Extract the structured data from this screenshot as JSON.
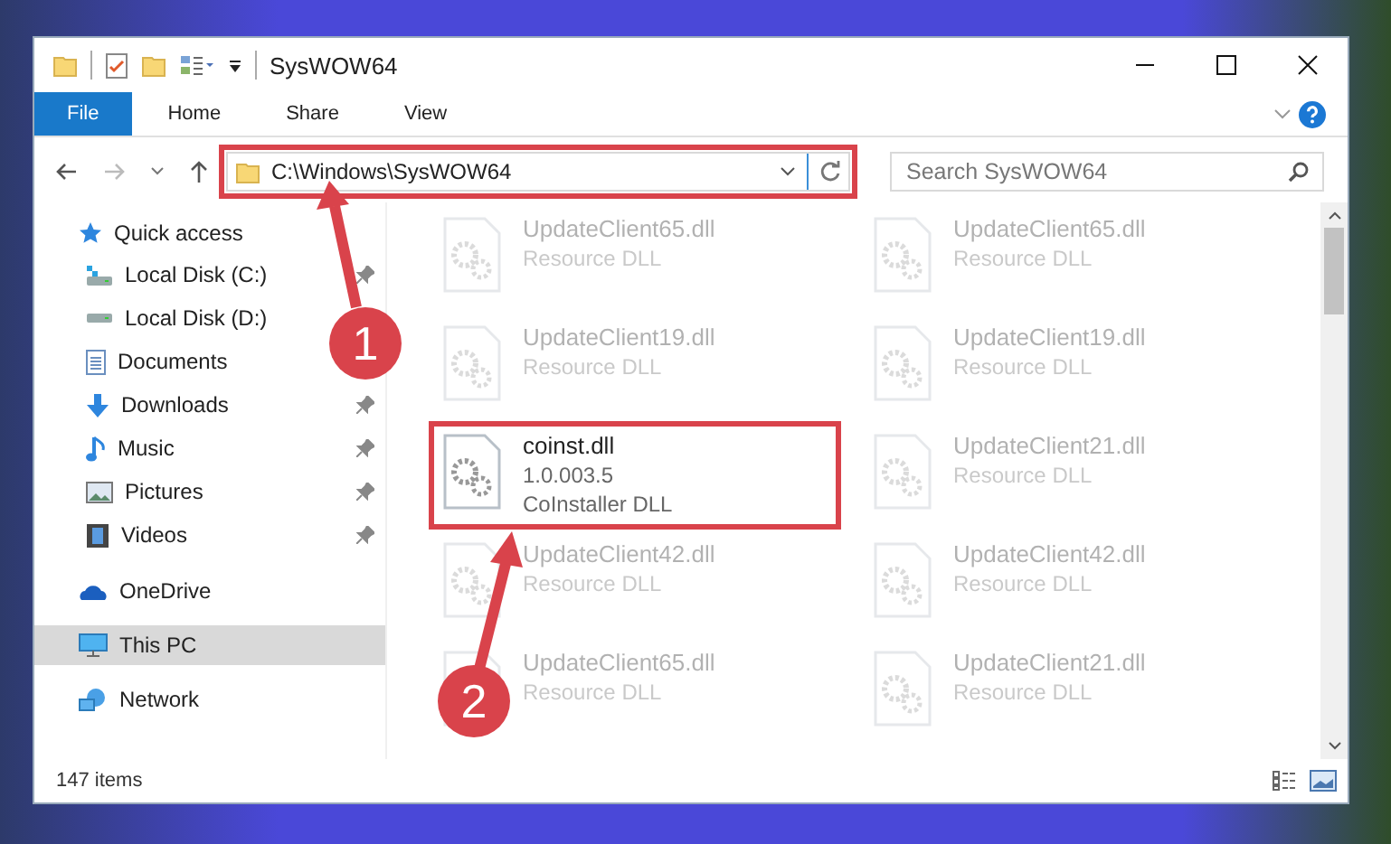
{
  "window": {
    "title": "SysWOW64"
  },
  "ribbon": {
    "tabs": [
      {
        "label": "File",
        "selected": true
      },
      {
        "label": "Home",
        "selected": false
      },
      {
        "label": "Share",
        "selected": false
      },
      {
        "label": "View",
        "selected": false
      }
    ]
  },
  "address": {
    "path": "C:\\Windows\\SysWOW64",
    "highlighted": true
  },
  "search": {
    "placeholder": "Search SysWOW64"
  },
  "sidebar": {
    "items": [
      {
        "label": "Quick access",
        "selected": false,
        "children": [
          {
            "label": "Local Disk (C:)",
            "pinned": true
          },
          {
            "label": "Local Disk (D:)",
            "pinned": false
          },
          {
            "label": "Documents",
            "pinned": false
          },
          {
            "label": "Downloads",
            "pinned": true
          },
          {
            "label": "Music",
            "pinned": true
          },
          {
            "label": "Pictures",
            "pinned": true
          },
          {
            "label": "Videos",
            "pinned": true
          }
        ]
      },
      {
        "label": "OneDrive",
        "selected": false
      },
      {
        "label": "This PC",
        "selected": true
      },
      {
        "label": "Network",
        "selected": false
      }
    ]
  },
  "files": [
    {
      "name": "UpdateClient65.dll",
      "details": [
        "Resource DLL"
      ],
      "blurred": true,
      "highlighted": false
    },
    {
      "name": "UpdateClient65.dll",
      "details": [
        "Resource DLL"
      ],
      "blurred": true,
      "highlighted": false
    },
    {
      "name": "UpdateClient19.dll",
      "details": [
        "Resource DLL"
      ],
      "blurred": true,
      "highlighted": false
    },
    {
      "name": "UpdateClient19.dll",
      "details": [
        "Resource DLL"
      ],
      "blurred": true,
      "highlighted": false
    },
    {
      "name": "coinst.dll",
      "details": [
        "1.0.003.5",
        "CoInstaller DLL"
      ],
      "blurred": false,
      "highlighted": true
    },
    {
      "name": "UpdateClient21.dll",
      "details": [
        "Resource DLL"
      ],
      "blurred": true,
      "highlighted": false
    },
    {
      "name": "UpdateClient42.dll",
      "details": [
        "Resource DLL"
      ],
      "blurred": true,
      "highlighted": false
    },
    {
      "name": "UpdateClient42.dll",
      "details": [
        "Resource DLL"
      ],
      "blurred": true,
      "highlighted": false
    },
    {
      "name": "UpdateClient65.dll",
      "details": [
        "Resource DLL"
      ],
      "blurred": true,
      "highlighted": false
    },
    {
      "name": "UpdateClient21.dll",
      "details": [
        "Resource DLL"
      ],
      "blurred": true,
      "highlighted": false
    }
  ],
  "status_bar": {
    "item_count": "147 items"
  },
  "annotations": [
    {
      "label": "1"
    },
    {
      "label": "2"
    }
  ]
}
